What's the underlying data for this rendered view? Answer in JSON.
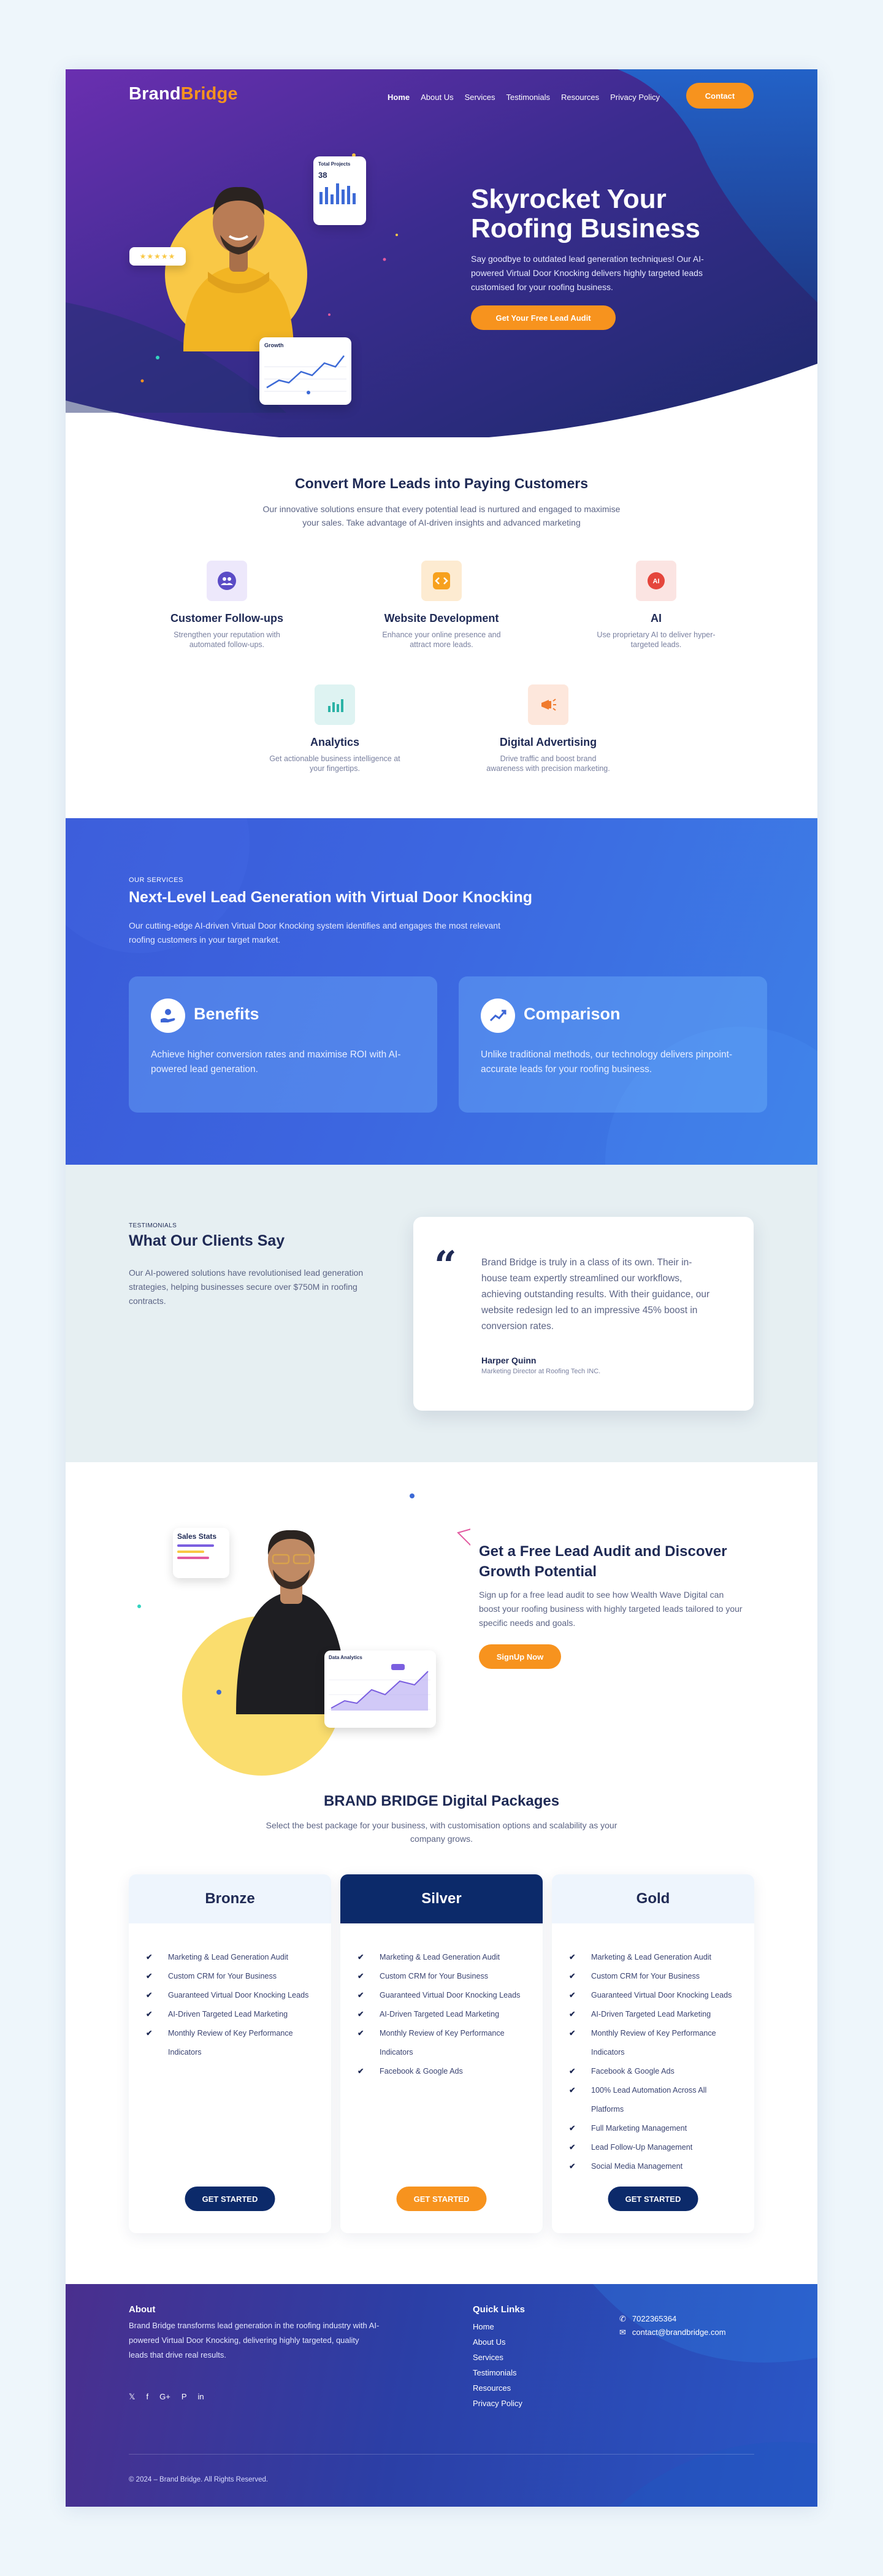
{
  "brand": {
    "name_part1": "Brand",
    "name_part2": "Bridge"
  },
  "nav": {
    "items": [
      "Home",
      "About Us",
      "Services",
      "Testimonials",
      "Resources",
      "Privacy Policy"
    ],
    "contact_label": "Contact"
  },
  "hero": {
    "title": "Skyrocket Your Roofing Business",
    "subtitle": "Say goodbye to outdated lead generation techniques! Our AI-powered Virtual Door Knocking delivers highly targeted leads customised for your roofing business.",
    "cta_label": "Get Your Free Lead Audit",
    "card_projects_title": "Total Projects",
    "card_projects_value": "38",
    "card_growth_title": "Growth",
    "stars": "★★★★★"
  },
  "convert": {
    "title": "Convert More Leads into Paying Customers",
    "description": "Our innovative solutions ensure that every potential lead is nurtured and engaged to maximise your sales. Take advantage of AI-driven insights and advanced marketing",
    "features": [
      {
        "title": "Customer Follow-ups",
        "desc": "Strengthen your reputation with automated follow-ups.",
        "icon": "users-icon",
        "color": "#ede8fb"
      },
      {
        "title": "Website Development",
        "desc": "Enhance your online presence and attract more leads.",
        "icon": "code-icon",
        "color": "#fdebd1"
      },
      {
        "title": "AI",
        "desc": "Use proprietary AI to deliver hyper-targeted leads.",
        "icon": "ai-chip-icon",
        "color": "#fbe4e2"
      },
      {
        "title": "Analytics",
        "desc": "Get actionable business intelligence at your fingertips.",
        "icon": "bar-chart-icon",
        "color": "#def3f2"
      },
      {
        "title": "Digital Advertising",
        "desc": "Drive traffic and boost brand awareness with precision marketing.",
        "icon": "megaphone-icon",
        "color": "#fde7dc"
      }
    ]
  },
  "services": {
    "kicker": "OUR SERVICES",
    "title": "Next-Level Lead Generation with Virtual Door Knocking",
    "description": "Our cutting-edge AI-driven Virtual Door Knocking system identifies and engages the most relevant roofing customers in your target market.",
    "cards": [
      {
        "title": "Benefits",
        "desc": "Achieve higher conversion rates and maximise ROI with AI-powered lead generation.",
        "icon": "hand-coins-icon"
      },
      {
        "title": "Comparison",
        "desc": "Unlike traditional methods, our technology delivers pinpoint-accurate leads for your roofing business.",
        "icon": "trend-arrows-icon"
      }
    ]
  },
  "testimonials": {
    "kicker": "TESTIMONIALS",
    "title": "What Our Clients Say",
    "description": "Our AI-powered solutions have revolutionised lead generation strategies, helping businesses secure over $750M in roofing contracts.",
    "quote_mark": "“",
    "quote": "Brand Bridge is truly in a class of its own. Their in-house team expertly streamlined our workflows, achieving outstanding results. With their guidance, our website redesign led to an impressive 45% boost in conversion rates.",
    "name": "Harper Quinn",
    "role": "Marketing Director at Roofing Tech INC."
  },
  "audit": {
    "title": "Get a Free Lead Audit and Discover Growth Potential",
    "description": "Sign up for a free lead audit to see how Wealth Wave Digital can boost your roofing business with highly targeted leads tailored to your specific needs and goals.",
    "cta_label": "SignUp Now",
    "card_sales_title": "Sales Stats",
    "card_data_title": "Data Analytics"
  },
  "packages": {
    "title": "BRAND BRIDGE Digital Packages",
    "description": "Select the best package for your business, with customisation options and scalability as your company grows.",
    "cta_label": "GET STARTED",
    "tiers": [
      {
        "name": "Bronze",
        "features": [
          "Marketing & Lead Generation Audit",
          "Custom CRM for Your Business",
          "Guaranteed Virtual Door Knocking Leads",
          "AI-Driven Targeted Lead Marketing",
          "Monthly Review of Key Performance Indicators"
        ]
      },
      {
        "name": "Silver",
        "features": [
          "Marketing & Lead Generation Audit",
          "Custom CRM for Your Business",
          "Guaranteed Virtual Door Knocking Leads",
          "AI-Driven Targeted Lead Marketing",
          "Monthly Review of Key Performance Indicators",
          "Facebook & Google Ads"
        ]
      },
      {
        "name": "Gold",
        "features": [
          "Marketing & Lead Generation Audit",
          "Custom CRM for Your Business",
          "Guaranteed Virtual Door Knocking Leads",
          "AI-Driven Targeted Lead Marketing",
          "Monthly Review of Key Performance Indicators",
          "Facebook & Google Ads",
          "100% Lead Automation Across All Platforms",
          "Full Marketing Management",
          "Lead Follow-Up Management",
          "Social Media Management"
        ]
      }
    ]
  },
  "footer": {
    "about_title": "About",
    "about_text": "Brand Bridge transforms lead generation in the roofing industry with AI-powered Virtual Door Knocking, delivering highly targeted, quality leads that drive real results.",
    "social_icons": [
      "twitter-icon",
      "facebook-icon",
      "google-icon",
      "pinterest-icon",
      "linkedin-icon"
    ],
    "links_title": "Quick Links",
    "links": [
      "Home",
      "About Us",
      "Services",
      "Testimonials",
      "Resources",
      "Privacy Policy"
    ],
    "phone": "7022365364",
    "email": "contact@brandbridge.com",
    "copyright": "© 2024 – Brand Bridge. All Rights Reserved."
  }
}
